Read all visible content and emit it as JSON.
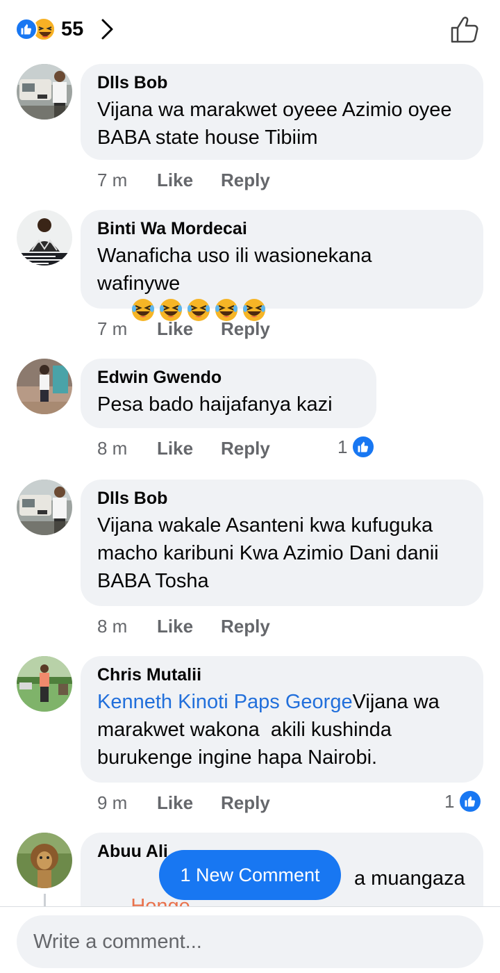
{
  "header": {
    "reaction_count": "55",
    "reaction_icons": [
      "like-icon",
      "haha-icon"
    ],
    "chevron_icon": "chevron-right-icon",
    "like_outline_icon": "thumbs-up-outline-icon"
  },
  "comments": [
    {
      "name": "Dlls Bob",
      "text": "Vijana wa marakwet oyeee Azimio oyee BABA state house Tibiim",
      "time": "7 m",
      "like": "Like",
      "reply": "Reply"
    },
    {
      "name": "Binti Wa Mordecai",
      "text": "Wanaficha uso ili wasionekana wafinywe",
      "emoji": [
        "haha-emoji",
        "haha-emoji",
        "haha-emoji",
        "haha-emoji",
        "haha-emoji"
      ],
      "time": "7 m",
      "like": "Like",
      "reply": "Reply"
    },
    {
      "name": "Edwin Gwendo",
      "text": "Pesa bado haijafanya kazi",
      "time": "8 m",
      "like": "Like",
      "reply": "Reply",
      "reactions": "1"
    },
    {
      "name": "Dlls Bob",
      "text": "Vijana wakale Asanteni kwa kufuguka macho karibuni Kwa Azimio Dani danii BABA Tosha",
      "time": "8 m",
      "like": "Like",
      "reply": "Reply"
    },
    {
      "name": "Chris Mutalii",
      "mention": "Kenneth Kinoti Paps George",
      "text": "Vijana wa marakwet wakona  akili kushinda burukenge ingine hapa Nairobi.",
      "time": "9 m",
      "like": "Like",
      "reply": "Reply",
      "reactions": "1"
    },
    {
      "name": "Abuu Ali",
      "mention_partial": "Honge",
      "text_partial": "a muangaza"
    }
  ],
  "new_comment_pill": "1 New Comment",
  "composer": {
    "placeholder": "Write a comment..."
  },
  "colors": {
    "brand": "#1877f2",
    "bubble": "#f0f2f5",
    "mention": "#216fdb",
    "muted": "#65676b"
  }
}
